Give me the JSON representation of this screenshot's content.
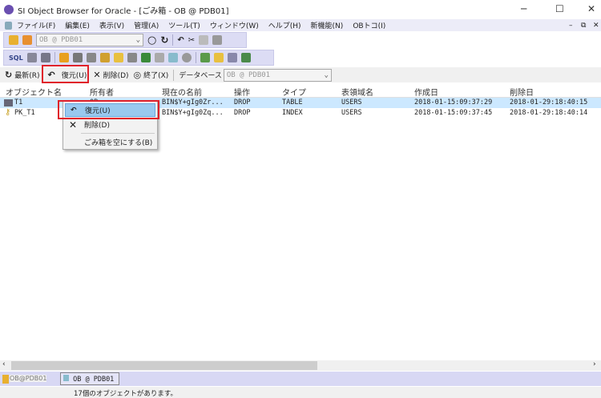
{
  "window": {
    "title": "SI Object Browser for Oracle - [ごみ箱 - OB @ PDB01]"
  },
  "menu": [
    "ファイル(F)",
    "編集(E)",
    "表示(V)",
    "管理(A)",
    "ツール(T)",
    "ウィンドウ(W)",
    "ヘルプ(H)",
    "新機能(N)",
    "OBトコ(I)"
  ],
  "toolbar": {
    "connection": "OB @ PDB01"
  },
  "actions": {
    "refresh": "最新(R)",
    "restore": "復元(U)",
    "delete": "削除(D)",
    "exit": "終了(X)",
    "db_label": "データベース",
    "db_value": "OB @ PDB01"
  },
  "table": {
    "headers": [
      "オブジェクト名",
      "所有者",
      "現在の名前",
      "操作",
      "タイプ",
      "表領域名",
      "作成日",
      "削除日"
    ],
    "rows": [
      {
        "name": "T1",
        "owner": "OB",
        "current": "BIN$Y+gIg0Zr...",
        "op": "DROP",
        "type": "TABLE",
        "ts": "USERS",
        "created": "2018-01-15:09:37:29",
        "deleted": "2018-01-29:18:40:15",
        "icon": "table-icon"
      },
      {
        "name": "PK_T1",
        "owner": "OB",
        "current": "BIN$Y+gIg0Zq...",
        "op": "DROP",
        "type": "INDEX",
        "ts": "USERS",
        "created": "2018-01-15:09:37:45",
        "deleted": "2018-01-29:18:40:14",
        "icon": "key-icon"
      }
    ]
  },
  "context_menu": {
    "restore": "復元(U)",
    "delete": "削除(D)",
    "empty": "ごみ箱を空にする(B)"
  },
  "tabs": {
    "left": "OB@PDB01",
    "active": "OB @ PDB01"
  },
  "status": {
    "text": "17個のオブジェクトがあります。"
  },
  "colors": {
    "highlight": "#e0202a",
    "selection": "#cce8ff",
    "toolbar": "#dcdcf4"
  }
}
